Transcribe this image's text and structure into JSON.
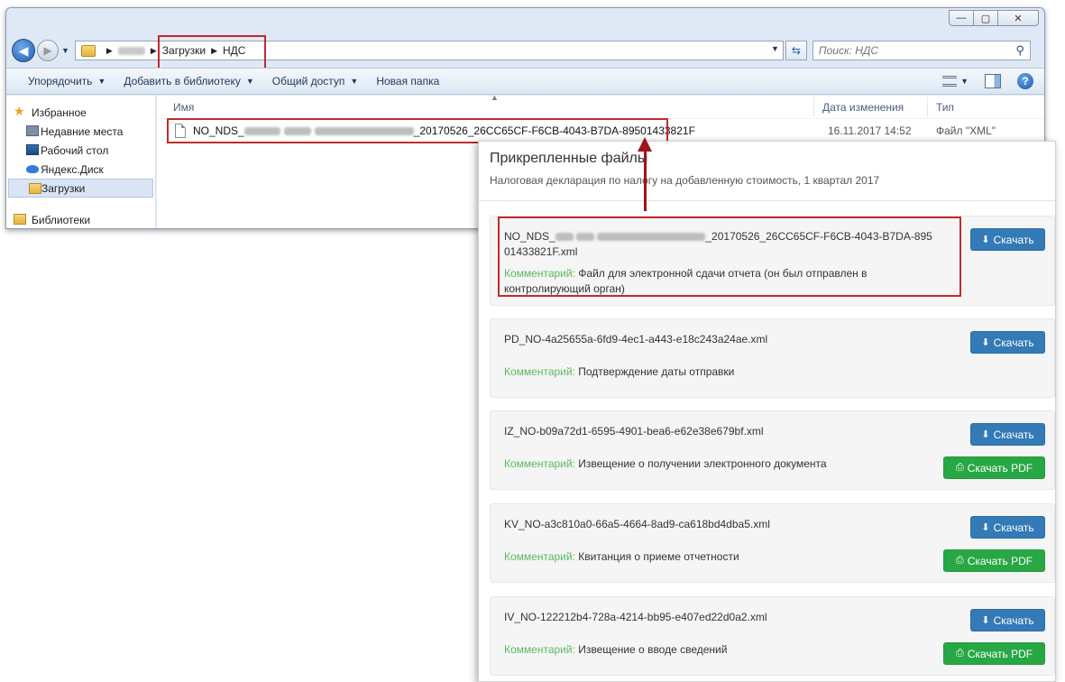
{
  "explorer": {
    "window_controls": {
      "minimize": "—",
      "maximize": "▢",
      "close": "✕"
    },
    "breadcrumb": [
      "Загрузки",
      "НДС"
    ],
    "search": {
      "placeholder": "Поиск: НДС"
    },
    "toolbar": [
      "Упорядочить",
      "Добавить в библиотеку",
      "Общий доступ",
      "Новая папка"
    ],
    "nav": {
      "favorites": "Избранное",
      "items": [
        "Недавние места",
        "Рабочий стол",
        "Яндекс.Диск",
        "Загрузки"
      ],
      "libraries": "Библиотеки"
    },
    "columns": {
      "name": "Имя",
      "date": "Дата изменения",
      "type": "Тип"
    },
    "file": {
      "name_prefix": "NO_NDS_",
      "name_suffix": "_20170526_26CC65CF-F6CB-4043-B7DA-89501433821F",
      "date": "16.11.2017 14:52",
      "type": "Файл \"XML\""
    }
  },
  "panel": {
    "title": "Прикрепленные файлы",
    "subtitle": "Налоговая декларация по налогу на добавленную стоимость, 1 квартал 2017",
    "comment_label": "Комментарий:",
    "download_label": "Скачать",
    "download_pdf_label": "Скачать PDF",
    "files": [
      {
        "name_prefix": "NO_NDS_",
        "name_suffix": "_20170526_26CC65CF-F6CB-4043-B7DA-89501433821F.xml",
        "comment": "Файл для электронной сдачи отчета (он был отправлен в контролирующий орган)"
      },
      {
        "name": "PD_NO-4a25655a-6fd9-4ec1-a443-e18c243a24ae.xml",
        "comment": "Подтверждение даты отправки"
      },
      {
        "name": "IZ_NO-b09a72d1-6595-4901-bea6-e62e38e679bf.xml",
        "comment": "Извещение о получении электронного документа"
      },
      {
        "name": "KV_NO-a3c810a0-66a5-4664-8ad9-ca618bd4dba5.xml",
        "comment": "Квитанция о приеме отчетности"
      },
      {
        "name": "IV_NO-122212b4-728a-4214-bb95-e407ed22d0a2.xml",
        "comment": "Извещение о вводе сведений"
      }
    ]
  },
  "colors": {
    "highlight": "#c22b2b",
    "download": "#337ab7",
    "pdf": "#28a745",
    "comment_label": "#5cb85c"
  }
}
